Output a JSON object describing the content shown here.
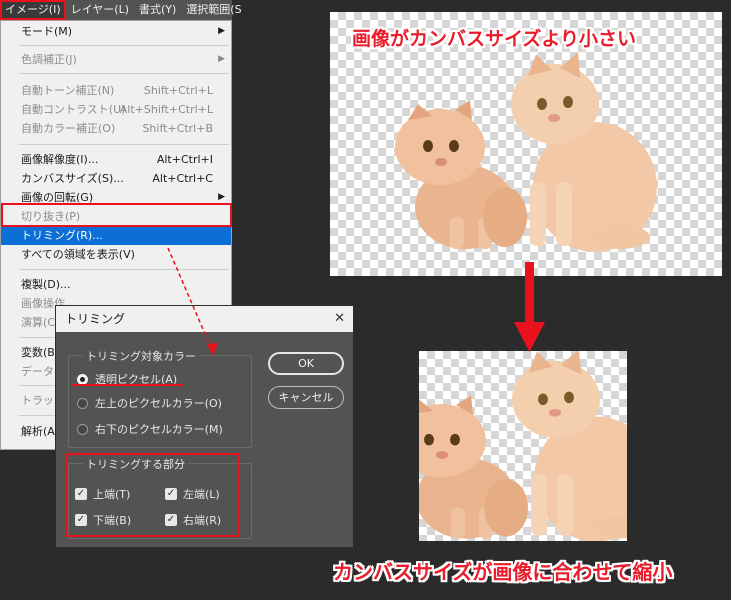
{
  "menubar": {
    "items": [
      "イメージ(I)",
      "レイヤー(L)",
      "書式(Y)",
      "選択範囲(S"
    ]
  },
  "menu": {
    "mode": "モード(M)",
    "tone": "色調補正(J)",
    "auto_tone": "自動トーン補正(N)",
    "auto_tone_sc": "Shift+Ctrl+L",
    "auto_contrast": "自動コントラスト(U)",
    "auto_contrast_sc": "Alt+Shift+Ctrl+L",
    "auto_color": "自動カラー補正(O)",
    "auto_color_sc": "Shift+Ctrl+B",
    "image_size": "画像解像度(I)...",
    "image_size_sc": "Alt+Ctrl+I",
    "canvas_size": "カンバスサイズ(S)...",
    "canvas_size_sc": "Alt+Ctrl+C",
    "rotate": "画像の回転(G)",
    "crop": "切り抜き(P)",
    "trim": "トリミング(R)...",
    "reveal_all": "すべての領域を表示(V)",
    "duplicate": "複製(D)...",
    "apply_image": "画像操作",
    "calculations": "演算(C",
    "variables": "変数(B",
    "data_set": "データセ",
    "trap": "トラッピ",
    "analysis": "解析(A"
  },
  "dialog": {
    "title": "トリミング",
    "close": "✕",
    "group1_title": "トリミング対象カラー",
    "radio_transparent": "透明ピクセル(A)",
    "radio_top_left": "左上のピクセルカラー(O)",
    "radio_bottom_right": "右下のピクセルカラー(M)",
    "group2_title": "トリミングする部分",
    "cb_top": "上端(T)",
    "cb_left": "左端(L)",
    "cb_bottom": "下端(B)",
    "cb_right": "右端(R)",
    "ok": "OK",
    "cancel": "キャンセル"
  },
  "captions": {
    "before": "画像がカンバスサイズより小さい",
    "after": "カンバスサイズが画像に合わせて縮小"
  },
  "colors": {
    "highlight_red": "#e8121d",
    "menu_highlight": "#0b6fd6",
    "caption_red": "#ea1b2a"
  }
}
